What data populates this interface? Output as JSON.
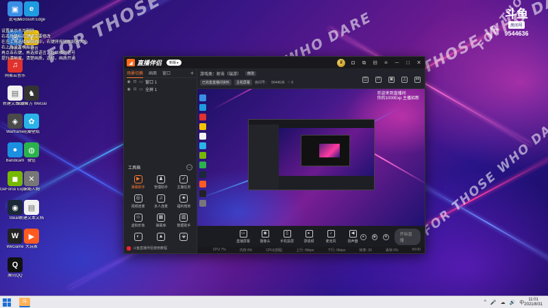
{
  "desktop": {
    "icons": [
      {
        "label": "此电脑",
        "glyph": "▣",
        "color": "#3a8ee6"
      },
      {
        "label": "回收站",
        "glyph": "✉",
        "color": "#2d7bd8"
      },
      {
        "label": "网易云音乐",
        "glyph": "♫",
        "color": "#e1322d"
      },
      {
        "label": "新建文本文档",
        "glyph": "▤",
        "color": "#f2f2f2"
      },
      {
        "label": "Warframe",
        "glyph": "◈",
        "color": "#4a4a4a"
      },
      {
        "label": "Bandicam",
        "glyph": "●",
        "color": "#1b8fe0"
      },
      {
        "label": "GeForce Experience",
        "glyph": "◼",
        "color": "#76b900"
      },
      {
        "label": "Steam",
        "glyph": "◉",
        "color": "#1b2838"
      },
      {
        "label": "WeGame",
        "glyph": "W",
        "color": "#222222"
      },
      {
        "label": "腾讯QQ",
        "glyph": "Q",
        "color": "#111111"
      },
      {
        "label": "Microsoft Edge",
        "glyph": "e",
        "color": "#1f9be0"
      },
      {
        "label": "YY语音",
        "glyph": "Y",
        "color": "#f5c400"
      },
      {
        "label": "深度官方 WeGame版",
        "glyph": "♞",
        "color": "#333333"
      },
      {
        "label": "花瓣壁纸",
        "glyph": "✿",
        "color": "#2ab3e8"
      },
      {
        "label": "微信",
        "glyph": "◍",
        "color": "#2bb24c"
      },
      {
        "label": "职场人物",
        "glyph": "✕",
        "color": "#777777"
      },
      {
        "label": "新建文本文档",
        "glyph": "▤",
        "color": "#f2f2f2"
      },
      {
        "label": "大玩家",
        "glyph": "▶",
        "color": "#ff5a1f"
      }
    ],
    "notice_lines": [
      "设置显示不可删除",
      "右击后鼠标右键点击要修改",
      "在左上角选择编辑器中，右键将按钮图纸放大小",
      "右上角设置模拟器",
      "再点击右键，再选择语言，粉丝横行信号",
      "提升清晰度，清楚画质，选择，画质开通"
    ],
    "wallpaper_text": [
      "FOR THOSE WHO DARE",
      "FOR THOSE WHO DARE",
      "FOR THOSE WHO DARE",
      "FOR THOSE WHO DARE",
      "FOR THOSE WHO DARE",
      "FOR THOSE WHO DARE"
    ]
  },
  "douyu": {
    "logo": "斗鱼",
    "room_label": "房间号",
    "room_number": "9544636"
  },
  "app": {
    "name": "直播伴侣",
    "version_pill": "新版 ▸",
    "tabs": [
      "场景切换",
      "画面",
      "窗口"
    ],
    "scenes": [
      {
        "name": "窗口 1",
        "eye": "◉",
        "lock": "⊡"
      },
      {
        "name": "全屏 1",
        "eye": "◉",
        "lock": "⊡"
      }
    ],
    "tools_title": "工具箱",
    "tools": [
      {
        "label": "弹幕助手",
        "glyph": "▶",
        "hot": true
      },
      {
        "label": "管理助手",
        "glyph": "♟",
        "hot": false
      },
      {
        "label": "主播任务",
        "glyph": "✓",
        "hot": false
      },
      {
        "label": "视频连麦",
        "glyph": "◎",
        "hot": false
      },
      {
        "label": "多人连麦",
        "glyph": "♫",
        "hot": false
      },
      {
        "label": "福利榜单",
        "glyph": "★",
        "hot": false
      },
      {
        "label": "虚拟形象",
        "glyph": "☺",
        "hot": false
      },
      {
        "label": "弹幕库",
        "glyph": "▦",
        "hot": false
      },
      {
        "label": "数据助手",
        "glyph": "▥",
        "hot": false
      },
      {
        "label": "",
        "glyph": "◐",
        "hot": false
      },
      {
        "label": "",
        "glyph": "▲",
        "hot": false
      },
      {
        "label": "",
        "glyph": "⬙",
        "hot": false
      }
    ],
    "footer_note": "斗鱼直播伴侣使用教程",
    "header": {
      "game_label": "游戏类：射击（端游）",
      "edit_label": "修改",
      "chip1": "已完善直播间资料",
      "chip2": "主机屏幕",
      "room_prefix": "房间号：",
      "room_number": "9544636",
      "fans": "♡ 0"
    },
    "preview_overlay": [
      "欢迎来到直播间",
      "你的1000Exp 主播招新"
    ],
    "controls": [
      {
        "label": "直播屏幕",
        "glyph": "▭"
      },
      {
        "label": "摄像头",
        "glyph": "◉"
      },
      {
        "label": "手机投屏",
        "glyph": "▯"
      },
      {
        "label": "录视频",
        "glyph": "▸"
      },
      {
        "label": "麦克风",
        "glyph": "♪"
      },
      {
        "label": "扬声器",
        "glyph": "◀"
      }
    ],
    "start_label": "开始直播",
    "status": [
      "CPU 7%",
      "内存 8%",
      "CPU(进程)",
      "上行: 0kbps",
      "下行: 0kbps",
      "帧率: 30",
      "丢帧 0%",
      "00:00"
    ]
  },
  "taskbar": {
    "app_glyph": "斗",
    "tray_icons": [
      "^",
      "🎤",
      "☁",
      "🔊",
      "中"
    ],
    "time": "11:01",
    "date": "2021/8/31"
  }
}
